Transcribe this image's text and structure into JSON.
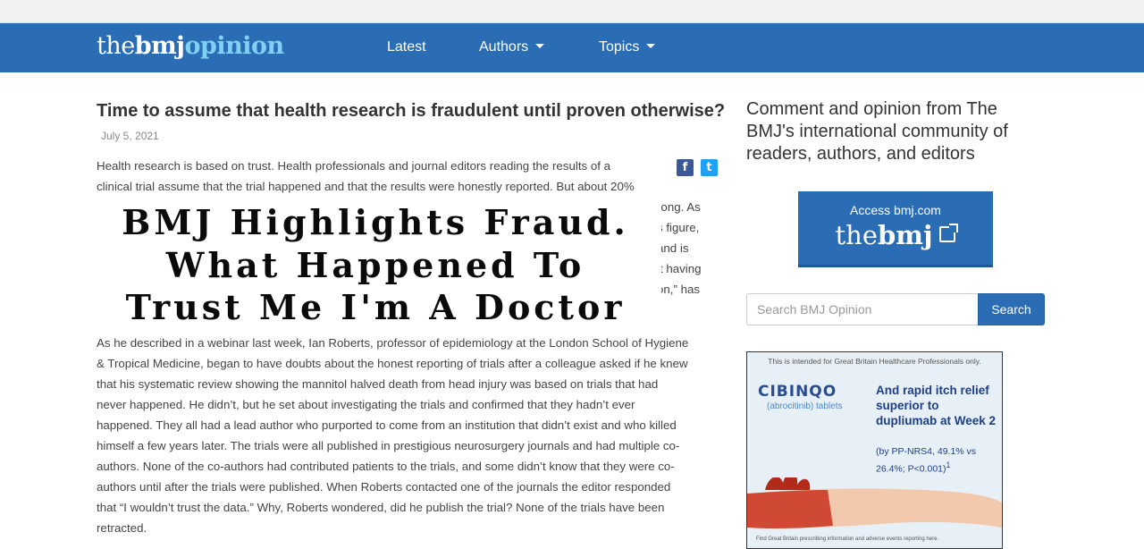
{
  "nav": {
    "logo": {
      "the": "the",
      "bmj": "bmj",
      "opinion": "opinion"
    },
    "items": [
      {
        "label": "Latest"
      },
      {
        "label": "Authors"
      },
      {
        "label": "Topics"
      }
    ]
  },
  "article": {
    "title": "Time to assume that health research is fraudulent until proven otherwise?",
    "date": "July 5, 2021",
    "para1_lines": [
      "Health research is based on trust. Health professionals and journal editors reading the results of a",
      "clinical trial assume that the trial happened and that the results were honestly reported. But about 20%"
    ],
    "para1_fragments": [
      "rong. As",
      "s figure,",
      "and is",
      "it having",
      "on,” has"
    ],
    "para2_lines": [
      "As he described in a webinar last week, Ian Roberts, professor of epidemiology at the London School of Hygiene",
      "& Tropical Medicine, began to have doubts about the honest reporting of trials after a colleague asked if he knew",
      "that his systematic review showing the mannitol halved death from head injury was based on trials that had",
      "never happened. He didn’t, but he set about investigating the trials and confirmed that they hadn’t ever",
      "happened. They all had a lead author who purported to come from an institution that didn’t exist and who killed",
      "himself a few years later. The trials were all published in prestigious neurosurgery journals and had multiple co-",
      "authors. None of the co-authors had contributed patients to the trials, and some didn’t know that they were co-",
      "authors until after the trials were published. When Roberts contacted one of the journals the editor responded",
      "that “I wouldn’t trust the data.” Why, Roberts wondered, did he publish the trial? None of the trials have been",
      "retracted."
    ]
  },
  "overlay": {
    "line1": "BMJ Highlights Fraud.",
    "line2": "What Happened To",
    "line3": "Trust Me I'm A Doctor"
  },
  "share": {
    "facebook": "f",
    "twitter": "t"
  },
  "sidebar": {
    "heading": "Comment and opinion from The BMJ's international community of readers, authors, and editors",
    "access": {
      "small": "Access bmj.com",
      "the": "the",
      "bmj": "bmj"
    },
    "search": {
      "placeholder": "Search BMJ Opinion",
      "button": "Search"
    }
  },
  "ad": {
    "notice": "This is intended for Great Britain Healthcare Professionals only.",
    "brand": "CIBINQO",
    "brand_sub": "(abrocitinib) tablets",
    "claim": "And rapid itch relief superior to dupliumab at Week 2",
    "claim_sub": "(by PP-NRS4, 49.1% vs 26.4%; P<0.001)",
    "claim_sup": "1",
    "footer": "Find Great Britain prescribing information and adverse events reporting here."
  },
  "colors": {
    "brand_blue": "#2b6db5",
    "logo_accent": "#7fd0f3"
  }
}
